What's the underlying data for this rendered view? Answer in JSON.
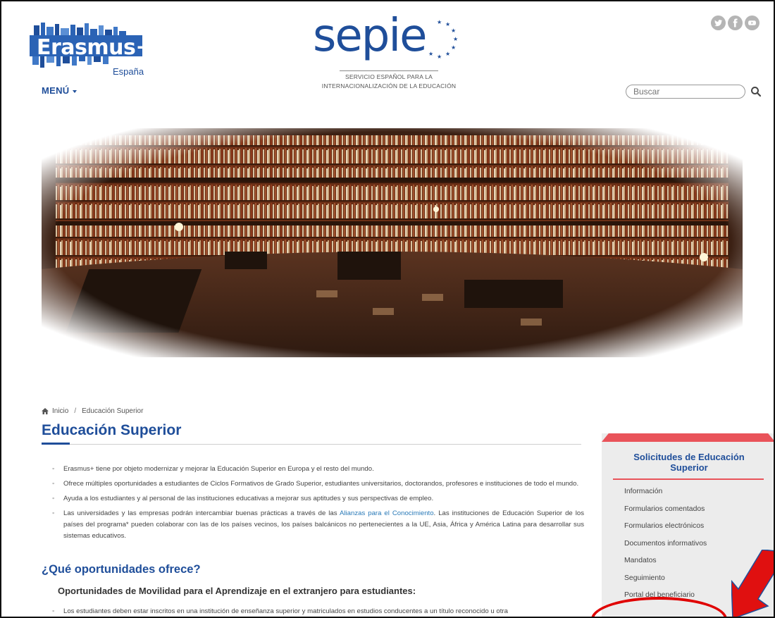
{
  "header": {
    "erasmus_logo": {
      "word": "Erasmus+",
      "country": "España"
    },
    "menu_label": "MENÚ",
    "sepie_logo": {
      "brand": "sepie",
      "tagline_line1": "SERVICIO ESPAÑOL PARA LA",
      "tagline_line2": "INTERNACIONALIZACIÓN DE LA EDUCACIÓN"
    },
    "social_icons": [
      "twitter-icon",
      "facebook-icon",
      "youtube-icon"
    ],
    "search": {
      "placeholder": "Buscar",
      "value": ""
    }
  },
  "hero": {
    "icon": "library-photo",
    "color_accent": "#7a3b1d"
  },
  "breadcrumb": {
    "home": "Inicio",
    "current": "Educación Superior"
  },
  "page_title": "Educación Superior",
  "bullets": [
    {
      "text": "Erasmus+ tiene por objeto modernizar y mejorar la Educación Superior en Europa y el resto del mundo."
    },
    {
      "text": "Ofrece múltiples oportunidades a estudiantes de Ciclos Formativos de Grado Superior, estudiantes universitarios, doctorandos, profesores e instituciones de todo el mundo."
    },
    {
      "text": "Ayuda a los estudiantes y al personal de las instituciones educativas a mejorar sus aptitudes y sus perspectivas de empleo."
    },
    {
      "before": "Las universidades y las empresas podrán intercambiar buenas prácticas a través de las ",
      "link": "Alianzas para el Conocimiento",
      "after": ". Las instituciones de Educación Superior de los países del programa* pueden colaborar con las de los países vecinos, los países balcánicos no pertenecientes a la UE, Asia, África y América Latina para desarrollar sus sistemas educativos."
    }
  ],
  "section_heading": "¿Qué oportunidades ofrece?",
  "sub_heading": "Oportunidades de Movilidad para el Aprendizaje en el extranjero para estudiantes:",
  "last_bullet": "Los estudiantes deben estar inscritos en una institución de enseñanza superior y matriculados en estudios conducentes a un título reconocido u otra",
  "sidebar": {
    "title": "Solicitudes de Educación Superior",
    "items": [
      "Información",
      "Formularios comentados",
      "Formularios electrónicos",
      "Documentos informativos",
      "Mandatos",
      "Seguimiento",
      "Portal del beneficiario"
    ]
  },
  "colors": {
    "brand_blue": "#1f4e9a",
    "accent_red": "#e9535a",
    "annotation_red": "#e00000"
  }
}
